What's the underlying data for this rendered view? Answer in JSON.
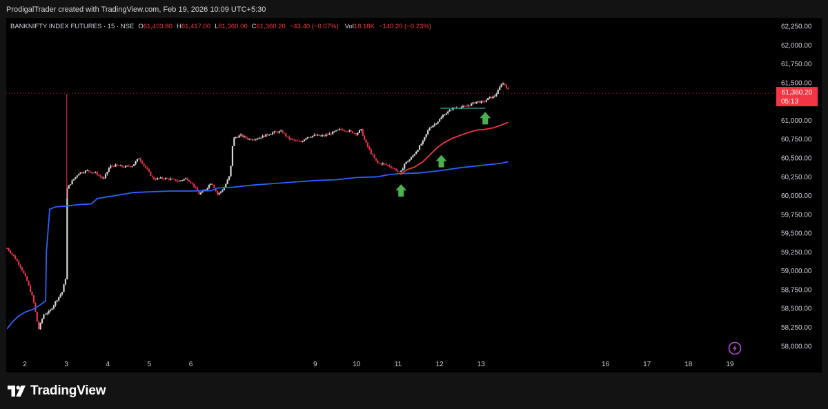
{
  "header": {
    "credit": "ProdigalTrader created with TradingView.com, Feb 19, 2026 10:09 UTC+5:30"
  },
  "footer": {
    "brand": "TradingView"
  },
  "colors": {
    "background": "#000000",
    "frame": "#131313",
    "candle_up": "#d9d9d9",
    "candle_down": "#e8344a",
    "vwap_blue": "#2962ff",
    "vwap_red": "#f23645",
    "range_line": "#26a69a",
    "arrow": "#4caf50",
    "price_label": "#f23645"
  },
  "chart_data": {
    "type": "candlestick",
    "symbol": "BANKNIFTY INDEX FUTURES · 15 · NSE",
    "legend": {
      "open_label": "O",
      "open": "61,403.80",
      "high_label": "H",
      "high": "61,417.00",
      "low_label": "L",
      "low": "61,360.00",
      "close_label": "C",
      "close": "61,360.20",
      "change": "−43.40 (−0.07%)",
      "vol_label": "Vol",
      "volume": "18.18K",
      "vol_change": "−140.20 (−0.23%)"
    },
    "last_price": {
      "price": "61,360.20",
      "countdown": "05:13",
      "value": 61360.2
    },
    "y_axis": {
      "range": [
        57925,
        62360
      ],
      "ticks": [
        {
          "value": 58000,
          "label": "58,000.00"
        },
        {
          "value": 58250,
          "label": "58,250.00"
        },
        {
          "value": 58500,
          "label": "58,500.00"
        },
        {
          "value": 58750,
          "label": "58,750.00"
        },
        {
          "value": 59000,
          "label": "59,000.00"
        },
        {
          "value": 59250,
          "label": "59,250.00"
        },
        {
          "value": 59500,
          "label": "59,500.00"
        },
        {
          "value": 59750,
          "label": "59,750.00"
        },
        {
          "value": 60000,
          "label": "60,000.00"
        },
        {
          "value": 60250,
          "label": "60,250.00"
        },
        {
          "value": 60500,
          "label": "60,500.00"
        },
        {
          "value": 60750,
          "label": "60,750.00"
        },
        {
          "value": 61000,
          "label": "61,000.00"
        },
        {
          "value": 61250,
          "label": "61,250.00"
        },
        {
          "value": 61500,
          "label": "61,500.00"
        },
        {
          "value": 61750,
          "label": "61,750.00"
        },
        {
          "value": 62000,
          "label": "62,000.00"
        },
        {
          "value": 62250,
          "label": "62,250.00"
        }
      ]
    },
    "x_axis": {
      "range": [
        1.55,
        19.85
      ],
      "ticks": [
        {
          "x": 2,
          "label": "2"
        },
        {
          "x": 3,
          "label": "3"
        },
        {
          "x": 4,
          "label": "4"
        },
        {
          "x": 5,
          "label": "5"
        },
        {
          "x": 6,
          "label": "6"
        },
        {
          "x": 9,
          "label": "9"
        },
        {
          "x": 10,
          "label": "10"
        },
        {
          "x": 11,
          "label": "11"
        },
        {
          "x": 12,
          "label": "12"
        },
        {
          "x": 13,
          "label": "13"
        },
        {
          "x": 16,
          "label": "16"
        },
        {
          "x": 17,
          "label": "17"
        },
        {
          "x": 18,
          "label": "18"
        },
        {
          "x": 19,
          "label": "19"
        }
      ]
    },
    "price_path": [
      [
        1.57,
        59300
      ],
      [
        1.75,
        59180
      ],
      [
        1.9,
        59050
      ],
      [
        2.05,
        58870
      ],
      [
        2.2,
        58620
      ],
      [
        2.33,
        58220
      ],
      [
        2.45,
        58420
      ],
      [
        2.6,
        58460
      ],
      [
        2.75,
        58600
      ],
      [
        2.9,
        58720
      ],
      [
        2.98,
        58900
      ],
      [
        3.02,
        60100
      ],
      [
        3.15,
        60200
      ],
      [
        3.3,
        60300
      ],
      [
        3.5,
        60330
      ],
      [
        3.7,
        60300
      ],
      [
        3.9,
        60220
      ],
      [
        4.05,
        60390
      ],
      [
        4.2,
        60400
      ],
      [
        4.4,
        60380
      ],
      [
        4.6,
        60400
      ],
      [
        4.75,
        60500
      ],
      [
        4.9,
        60380
      ],
      [
        5.1,
        60220
      ],
      [
        5.3,
        60230
      ],
      [
        5.5,
        60220
      ],
      [
        5.7,
        60190
      ],
      [
        5.9,
        60230
      ],
      [
        6.05,
        60150
      ],
      [
        6.2,
        60020
      ],
      [
        6.35,
        60080
      ],
      [
        6.5,
        60180
      ],
      [
        6.65,
        60010
      ],
      [
        6.8,
        60100
      ],
      [
        6.95,
        60280
      ],
      [
        7.02,
        60760
      ],
      [
        7.2,
        60800
      ],
      [
        7.4,
        60750
      ],
      [
        7.6,
        60760
      ],
      [
        7.8,
        60800
      ],
      [
        8.0,
        60840
      ],
      [
        8.2,
        60850
      ],
      [
        8.35,
        60760
      ],
      [
        8.5,
        60730
      ],
      [
        8.65,
        60710
      ],
      [
        8.8,
        60780
      ],
      [
        9.0,
        60800
      ],
      [
        9.2,
        60790
      ],
      [
        9.4,
        60830
      ],
      [
        9.6,
        60880
      ],
      [
        9.8,
        60860
      ],
      [
        10.0,
        60820
      ],
      [
        10.1,
        60880
      ],
      [
        10.2,
        60720
      ],
      [
        10.35,
        60560
      ],
      [
        10.5,
        60430
      ],
      [
        10.65,
        60420
      ],
      [
        10.8,
        60390
      ],
      [
        10.95,
        60340
      ],
      [
        11.05,
        60290
      ],
      [
        11.15,
        60420
      ],
      [
        11.3,
        60490
      ],
      [
        11.45,
        60600
      ],
      [
        11.6,
        60720
      ],
      [
        11.75,
        60900
      ],
      [
        11.9,
        60960
      ],
      [
        12.02,
        61020
      ],
      [
        12.1,
        61080
      ],
      [
        12.2,
        61110
      ],
      [
        12.3,
        61160
      ],
      [
        12.45,
        61170
      ],
      [
        12.6,
        61180
      ],
      [
        12.75,
        61210
      ],
      [
        12.9,
        61250
      ],
      [
        13.05,
        61240
      ],
      [
        13.2,
        61300
      ],
      [
        13.3,
        61310
      ],
      [
        13.4,
        61380
      ],
      [
        13.5,
        61500
      ],
      [
        13.58,
        61470
      ],
      [
        13.65,
        61400
      ]
    ],
    "series": [
      {
        "name": "Anchored VWAP (blue)",
        "points": [
          [
            1.57,
            58230
          ],
          [
            1.7,
            58320
          ],
          [
            1.85,
            58400
          ],
          [
            2.0,
            58450
          ],
          [
            2.2,
            58490
          ],
          [
            2.35,
            58540
          ],
          [
            2.5,
            58600
          ],
          [
            2.52,
            59260
          ],
          [
            2.6,
            59820
          ],
          [
            2.75,
            59850
          ],
          [
            3.0,
            59860
          ],
          [
            3.3,
            59880
          ],
          [
            3.6,
            59890
          ],
          [
            3.75,
            59960
          ],
          [
            3.95,
            59980
          ],
          [
            4.3,
            60010
          ],
          [
            4.6,
            60040
          ],
          [
            5.0,
            60050
          ],
          [
            5.5,
            60060
          ],
          [
            6.0,
            60060
          ],
          [
            6.5,
            60065
          ],
          [
            6.65,
            60100
          ],
          [
            7.0,
            60110
          ],
          [
            7.5,
            60140
          ],
          [
            8.0,
            60160
          ],
          [
            8.5,
            60180
          ],
          [
            9.0,
            60200
          ],
          [
            9.5,
            60210
          ],
          [
            10.0,
            60240
          ],
          [
            10.5,
            60250
          ],
          [
            10.8,
            60280
          ],
          [
            11.0,
            60290
          ],
          [
            11.5,
            60300
          ],
          [
            12.0,
            60330
          ],
          [
            12.5,
            60370
          ],
          [
            13.0,
            60400
          ],
          [
            13.5,
            60430
          ],
          [
            13.65,
            60450
          ]
        ]
      },
      {
        "name": "Anchored VWAP (red)",
        "points": [
          [
            11.05,
            60280
          ],
          [
            11.2,
            60340
          ],
          [
            11.4,
            60380
          ],
          [
            11.6,
            60450
          ],
          [
            11.8,
            60560
          ],
          [
            11.95,
            60640
          ],
          [
            12.1,
            60700
          ],
          [
            12.3,
            60760
          ],
          [
            12.5,
            60800
          ],
          [
            12.7,
            60840
          ],
          [
            12.9,
            60870
          ],
          [
            13.1,
            60880
          ],
          [
            13.3,
            60900
          ],
          [
            13.5,
            60940
          ],
          [
            13.58,
            60960
          ],
          [
            13.65,
            60970
          ]
        ]
      }
    ],
    "range_line": {
      "from": [
        12.02,
        61160
      ],
      "to": [
        13.1,
        61160
      ]
    },
    "signals": [
      {
        "x": 11.07,
        "price": 60150
      },
      {
        "x": 12.04,
        "price": 60540
      },
      {
        "x": 13.1,
        "price": 61110
      }
    ],
    "grid": false,
    "legend_position": "top-left"
  }
}
